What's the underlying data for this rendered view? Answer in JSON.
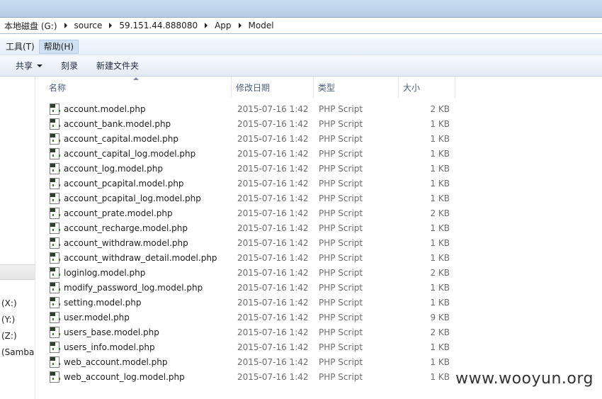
{
  "breadcrumb": [
    "本地磁盘 (G:)",
    "source",
    "59.151.44.888080",
    "App",
    "Model"
  ],
  "menu": [
    {
      "label": "工具(T)",
      "active": false
    },
    {
      "label": "帮助(H)",
      "active": true
    }
  ],
  "toolbar": {
    "share_label": "共享",
    "burn_label": "刻录",
    "new_folder_label": "新建文件夹"
  },
  "nav": {
    "drives": [
      "(X:)",
      "(Y:)",
      "(Z:)",
      "(Samba"
    ]
  },
  "columns": {
    "name": "名称",
    "date": "修改日期",
    "type": "类型",
    "size": "大小"
  },
  "files": [
    {
      "name": "account.model.php",
      "date": "2015-07-16 1:42",
      "type": "PHP Script",
      "size": "2 KB"
    },
    {
      "name": "account_bank.model.php",
      "date": "2015-07-16 1:42",
      "type": "PHP Script",
      "size": "1 KB"
    },
    {
      "name": "account_capital.model.php",
      "date": "2015-07-16 1:42",
      "type": "PHP Script",
      "size": "1 KB"
    },
    {
      "name": "account_capital_log.model.php",
      "date": "2015-07-16 1:42",
      "type": "PHP Script",
      "size": "1 KB"
    },
    {
      "name": "account_log.model.php",
      "date": "2015-07-16 1:42",
      "type": "PHP Script",
      "size": "1 KB"
    },
    {
      "name": "account_pcapital.model.php",
      "date": "2015-07-16 1:42",
      "type": "PHP Script",
      "size": "1 KB"
    },
    {
      "name": "account_pcapital_log.model.php",
      "date": "2015-07-16 1:42",
      "type": "PHP Script",
      "size": "1 KB"
    },
    {
      "name": "account_prate.model.php",
      "date": "2015-07-16 1:42",
      "type": "PHP Script",
      "size": "2 KB"
    },
    {
      "name": "account_recharge.model.php",
      "date": "2015-07-16 1:42",
      "type": "PHP Script",
      "size": "1 KB"
    },
    {
      "name": "account_withdraw.model.php",
      "date": "2015-07-16 1:42",
      "type": "PHP Script",
      "size": "1 KB"
    },
    {
      "name": "account_withdraw_detail.model.php",
      "date": "2015-07-16 1:42",
      "type": "PHP Script",
      "size": "1 KB"
    },
    {
      "name": "loginlog.model.php",
      "date": "2015-07-16 1:42",
      "type": "PHP Script",
      "size": "2 KB"
    },
    {
      "name": "modify_password_log.model.php",
      "date": "2015-07-16 1:42",
      "type": "PHP Script",
      "size": "1 KB"
    },
    {
      "name": "setting.model.php",
      "date": "2015-07-16 1:42",
      "type": "PHP Script",
      "size": "1 KB"
    },
    {
      "name": "user.model.php",
      "date": "2015-07-16 1:42",
      "type": "PHP Script",
      "size": "9 KB"
    },
    {
      "name": "users_base.model.php",
      "date": "2015-07-16 1:42",
      "type": "PHP Script",
      "size": "2 KB"
    },
    {
      "name": "users_info.model.php",
      "date": "2015-07-16 1:42",
      "type": "PHP Script",
      "size": "1 KB"
    },
    {
      "name": "web_account.model.php",
      "date": "2015-07-16 1:42",
      "type": "PHP Script",
      "size": "1 KB"
    },
    {
      "name": "web_account_log.model.php",
      "date": "2015-07-16 1:42",
      "type": "PHP Script",
      "size": "1 KB"
    }
  ],
  "icons": {
    "file": "php-file-icon",
    "crumb_separator": "chevron-right-icon",
    "share_caret": "caret-down-icon"
  },
  "watermark": "www.wooyun.org"
}
